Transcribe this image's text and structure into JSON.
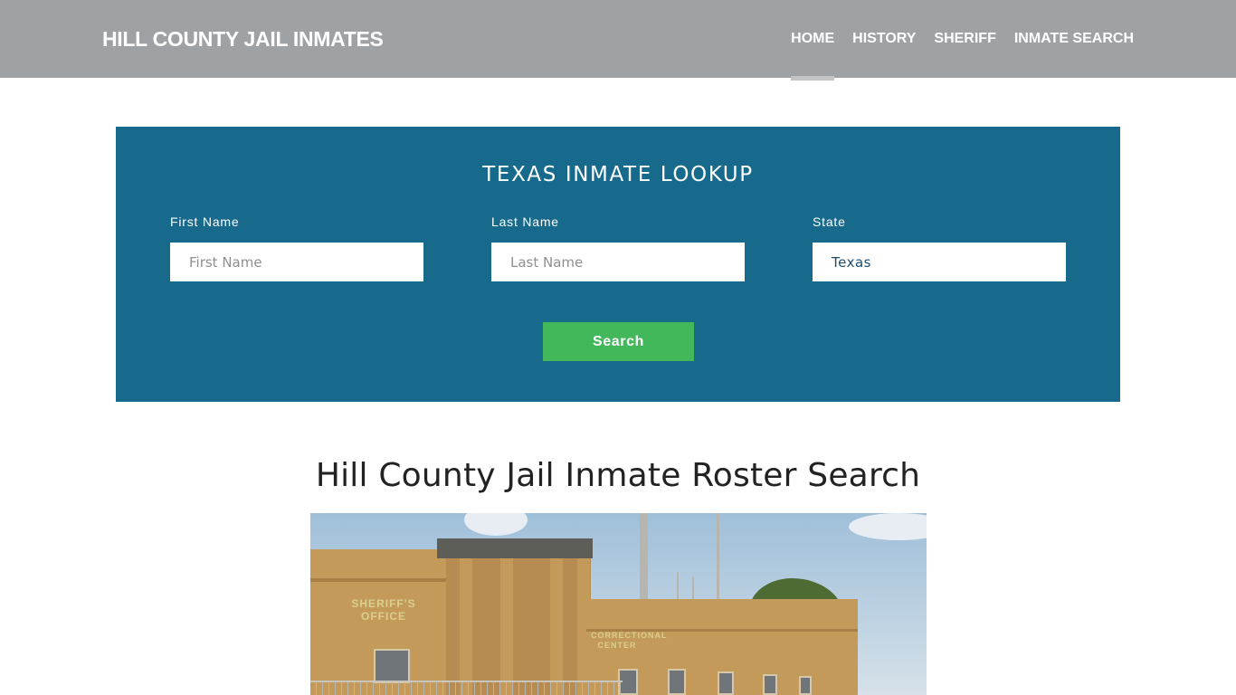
{
  "header": {
    "brand": "HILL COUNTY JAIL INMATES",
    "nav": [
      {
        "label": "HOME",
        "active": true
      },
      {
        "label": "HISTORY",
        "active": false
      },
      {
        "label": "SHERIFF",
        "active": false
      },
      {
        "label": "INMATE SEARCH",
        "active": false
      }
    ]
  },
  "lookup": {
    "title": "TEXAS INMATE LOOKUP",
    "first_name": {
      "label": "First Name",
      "placeholder": "First Name",
      "value": ""
    },
    "last_name": {
      "label": "Last Name",
      "placeholder": "Last Name",
      "value": ""
    },
    "state": {
      "label": "State",
      "value": "Texas"
    },
    "search_button": "Search",
    "colors": {
      "panel": "#176a8c",
      "button": "#43b85a"
    }
  },
  "main": {
    "title": "Hill County Jail Inmate Roster Search",
    "photo": {
      "alt": "Hill County Sheriff's Office and Correctional Center building",
      "sign_office": "SHERIFF'S OFFICE",
      "sign_correctional": "CORRECTIONAL CENTER"
    }
  }
}
